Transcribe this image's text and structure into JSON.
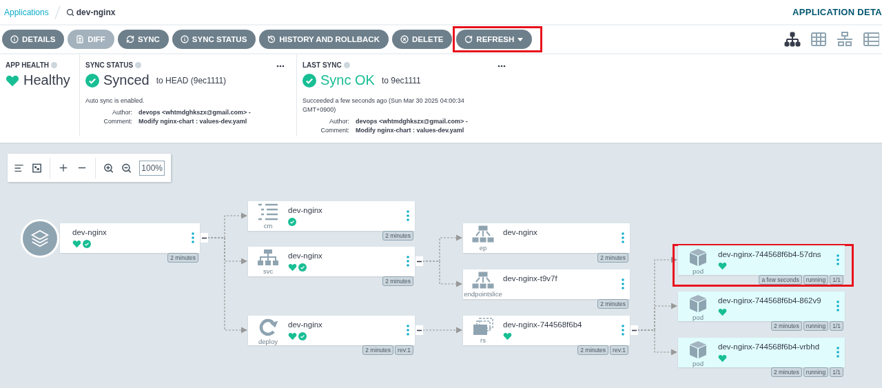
{
  "breadcrumb": {
    "root": "Applications",
    "current": "dev-nginx"
  },
  "page_title": "APPLICATION DETA",
  "toolbar": [
    {
      "kind": "details",
      "label": "DETAILS",
      "disabled": false,
      "dropdown": false,
      "highlighted": false
    },
    {
      "kind": "diff",
      "label": "DIFF",
      "disabled": true,
      "dropdown": false,
      "highlighted": false
    },
    {
      "kind": "sync",
      "label": "SYNC",
      "disabled": false,
      "dropdown": false,
      "highlighted": false
    },
    {
      "kind": "details",
      "label": "SYNC STATUS",
      "disabled": false,
      "dropdown": false,
      "highlighted": false
    },
    {
      "kind": "history",
      "label": "HISTORY AND ROLLBACK",
      "disabled": false,
      "dropdown": false,
      "highlighted": false
    },
    {
      "kind": "delete",
      "label": "DELETE",
      "disabled": false,
      "dropdown": false,
      "highlighted": false
    },
    {
      "kind": "refresh",
      "label": "REFRESH",
      "disabled": false,
      "dropdown": true,
      "highlighted": true
    }
  ],
  "views": [
    {
      "kind": "tree",
      "selected": true
    },
    {
      "kind": "pods",
      "selected": false
    },
    {
      "kind": "network",
      "selected": false
    },
    {
      "kind": "list",
      "selected": false
    }
  ],
  "app_health": {
    "title": "APP HEALTH",
    "status": "Healthy"
  },
  "sync_status": {
    "title": "SYNC STATUS",
    "status": "Synced",
    "target": "to HEAD (9ec1111)",
    "note": "Auto sync is enabled.",
    "author_label": "Author:",
    "author": "devops <whtmdghkszx@gmail.com> -",
    "comment_label": "Comment:",
    "comment": "Modify nginx-chart : values-dev.yaml"
  },
  "last_sync": {
    "title": "LAST SYNC",
    "status": "Sync OK",
    "target": "to 9ec1111",
    "note": "Succeeded a few seconds ago (Sun Mar 30 2025 04:00:34 GMT+0900)",
    "author_label": "Author:",
    "author": "devops <whtmdghkszx@gmail.com> -",
    "comment_label": "Comment:",
    "comment": "Modify nginx-chart : values-dev.yaml"
  },
  "graph_controls": {
    "zoom": "100%"
  },
  "tree": {
    "kind": "app",
    "name": "dev-nginx",
    "healthy": true,
    "synced": true,
    "expanded": true,
    "highlighted": false,
    "badges": [
      "2 minutes"
    ],
    "children": [
      {
        "kind": "cm",
        "type_label": "cm",
        "name": "dev-nginx",
        "healthy": false,
        "synced": true,
        "highlighted": false,
        "badges": [
          "2 minutes"
        ]
      },
      {
        "kind": "svc",
        "type_label": "svc",
        "name": "dev-nginx",
        "healthy": true,
        "synced": true,
        "expanded": true,
        "highlighted": false,
        "badges": [
          "2 minutes"
        ],
        "children": [
          {
            "kind": "ep",
            "type_label": "ep",
            "name": "dev-nginx",
            "healthy": false,
            "synced": false,
            "highlighted": false,
            "badges": [
              "2 minutes"
            ]
          },
          {
            "kind": "ep",
            "type_label": "endpointslice",
            "name": "dev-nginx-t9v7f",
            "healthy": false,
            "synced": false,
            "highlighted": false,
            "badges": [
              "2 minutes"
            ]
          }
        ]
      },
      {
        "kind": "deploy",
        "type_label": "deploy",
        "name": "dev-nginx",
        "healthy": true,
        "synced": true,
        "expanded": true,
        "highlighted": false,
        "badges": [
          "2 minutes",
          "rev:1"
        ],
        "children": [
          {
            "kind": "rs",
            "type_label": "rs",
            "name": "dev-nginx-744568f6b4",
            "healthy": true,
            "synced": false,
            "expanded": true,
            "highlighted": false,
            "badges": [
              "2 minutes",
              "rev:1"
            ],
            "children": [
              {
                "kind": "pod",
                "type_label": "pod",
                "name": "dev-nginx-744568f6b4-57dns",
                "healthy": true,
                "synced": false,
                "highlighted": true,
                "badges": [
                  "a few seconds",
                  "running",
                  "1/1"
                ]
              },
              {
                "kind": "pod",
                "type_label": "pod",
                "name": "dev-nginx-744568f6b4-862v9",
                "healthy": true,
                "synced": false,
                "highlighted": false,
                "badges": [
                  "2 minutes",
                  "running",
                  "1/1"
                ]
              },
              {
                "kind": "pod",
                "type_label": "pod",
                "name": "dev-nginx-744568f6b4-vrbhd",
                "healthy": true,
                "synced": false,
                "highlighted": false,
                "badges": [
                  "2 minutes",
                  "running",
                  "1/1"
                ]
              }
            ]
          }
        ]
      }
    ]
  }
}
